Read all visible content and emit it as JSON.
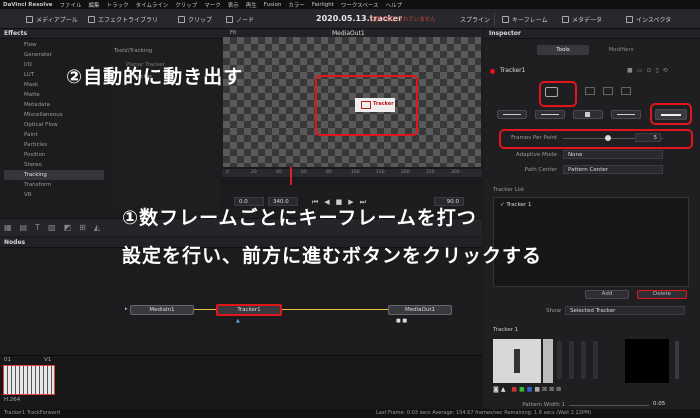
{
  "menubar": {
    "items": [
      "DaVinci Resolve",
      "ファイル",
      "編集",
      "トラック",
      "タイムライン",
      "クリップ",
      "マーク",
      "表示",
      "再生",
      "Fusion",
      "カラー",
      "Fairlight",
      "ワークスペース",
      "ヘルプ"
    ]
  },
  "toolbar": {
    "media_pool": "メディアプール",
    "effects_library": "エフェクトライブラリ",
    "clips": "クリップ",
    "nodes": "ノード",
    "project_title": "2020.05.13.tracker",
    "unsaved_notice": "変更が保存されていません",
    "spline": "スプライン",
    "keyframes": "キーフレーム",
    "metadata": "メタデータ",
    "inspector": "インスペクタ"
  },
  "effects": {
    "header": "Effects",
    "items": [
      "Flow",
      "Generator",
      "I/O",
      "LUT",
      "Mask",
      "Matte",
      "Metadata",
      "Miscellaneous",
      "Optical Flow",
      "Paint",
      "Particles",
      "Position",
      "Stereo",
      "Tracking",
      "Transform",
      "VR"
    ],
    "selected": "Tracking"
  },
  "tools": {
    "path": "Tools\\Tracking",
    "items": [
      "Planar Tracker",
      "Tracker"
    ]
  },
  "viewer": {
    "zoom": "Fit",
    "title": "MediaOut1",
    "timecode_start": "0.0",
    "timecode_mid": "340.0",
    "timecode_end": "90.0",
    "ruler": [
      "0",
      "20",
      "40",
      "60",
      "80",
      "100",
      "150",
      "200",
      "250",
      "300"
    ]
  },
  "annotation": {
    "step2": "②自動的に動き出す",
    "step1_line1": "①数フレームごとにキーフレームを打つ",
    "step1_line2": "設定を行い、前方に進むボタンをクリックする"
  },
  "nodes": {
    "header": "Nodes",
    "media_in": "MediaIn1",
    "tracker": "Tracker1",
    "media_out": "MediaOut1",
    "v1": "V1"
  },
  "clip": {
    "index": "01",
    "codec": "H.264"
  },
  "inspector": {
    "header": "Inspector",
    "tab_tools": "Tools",
    "tab_modifiers": "Modifiers",
    "node_name": "Tracker1",
    "frames_per_point_label": "Frames Per Point",
    "frames_per_point_value": "5",
    "frames_per_point_fraction": 0.45,
    "adaptive_mode_label": "Adaptive Mode",
    "adaptive_mode_value": "None",
    "path_center_label": "Path Center",
    "path_center_value": "Pattern Center",
    "tracker_list_label": "Tracker List",
    "tracker_item": "Tracker 1",
    "add": "Add",
    "delete": "Delete",
    "show_label": "Show",
    "show_value": "Selected Tracker",
    "tracker_section": "Tracker 1",
    "pattern_width_label": "Pattern Width 1",
    "pattern_width_value": "0.05",
    "accent_color": "#e0161c"
  },
  "status": {
    "left": "Tracker1 TrackForward",
    "right": "Last Frame: 0.03 secs  Average: 154.67 frames/sec  Remaining: 1.6 secs (Wait 2.22PM)"
  }
}
